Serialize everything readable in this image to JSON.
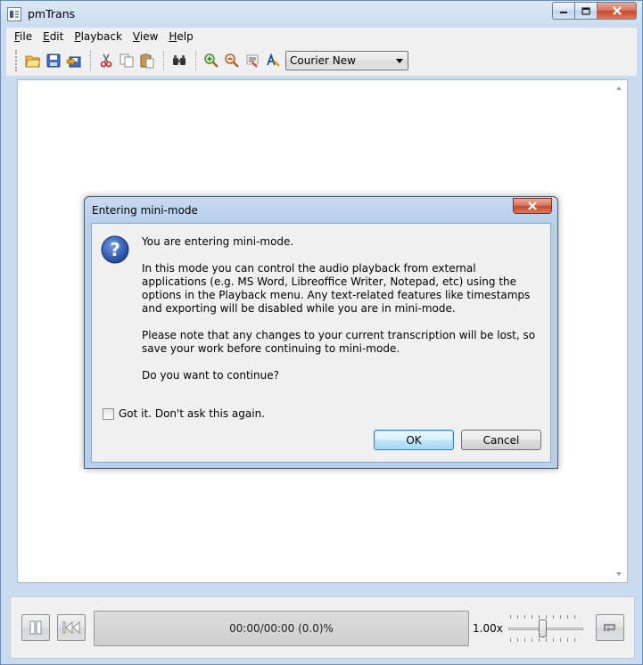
{
  "window": {
    "title": "pmTrans"
  },
  "menubar": {
    "items": [
      "File",
      "Edit",
      "Playback",
      "View",
      "Help"
    ]
  },
  "toolbar": {
    "buttons": [
      "open-icon",
      "save-icon",
      "save-as-icon",
      "cut-icon",
      "copy-icon",
      "paste-icon",
      "find-icon",
      "zoom-in-icon",
      "zoom-out-icon",
      "background-color-icon",
      "font-color-icon"
    ],
    "font": "Courier New"
  },
  "player": {
    "progress_text": "00:00/00:00 (0.0)%",
    "speed": "1.00x",
    "speed_slider_value": 0.45
  },
  "dialog": {
    "title": "Entering mini-mode",
    "close_label": "x",
    "paragraphs": [
      "You are entering mini-mode.",
      "In this mode you can control the audio playback from external applications (e.g. MS Word, Libreoffice Writer, Notepad, etc) using the options in the Playback menu. Any text-related features like timestamps and exporting will be disabled while you are in mini-mode.",
      "Please note that any changes to your current transcription will be lost, so save your work before continuing to mini-mode.",
      "Do you want to continue?"
    ],
    "checkbox_label": "Got it. Don't ask this again.",
    "checkbox_checked": false,
    "ok_label": "OK",
    "cancel_label": "Cancel"
  },
  "colors": {
    "titlebar": "#c9dbef",
    "accent": "#3c7fb1",
    "close": "#c8482d"
  }
}
